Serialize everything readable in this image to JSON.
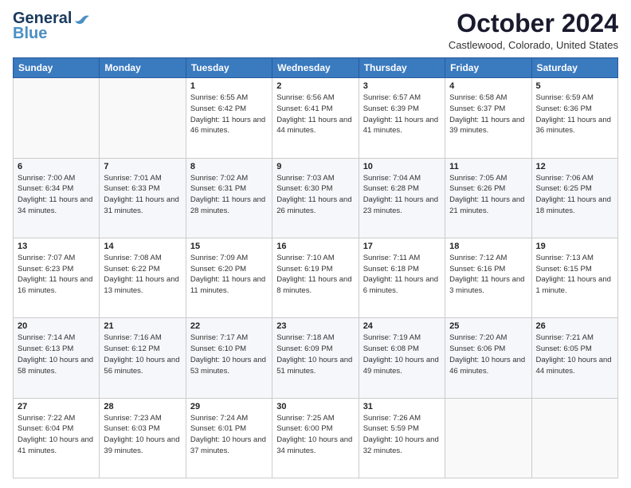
{
  "header": {
    "logo_line1": "General",
    "logo_line2": "Blue",
    "month": "October 2024",
    "location": "Castlewood, Colorado, United States"
  },
  "days_of_week": [
    "Sunday",
    "Monday",
    "Tuesday",
    "Wednesday",
    "Thursday",
    "Friday",
    "Saturday"
  ],
  "weeks": [
    [
      {
        "day": "",
        "sunrise": "",
        "sunset": "",
        "daylight": ""
      },
      {
        "day": "",
        "sunrise": "",
        "sunset": "",
        "daylight": ""
      },
      {
        "day": "1",
        "sunrise": "Sunrise: 6:55 AM",
        "sunset": "Sunset: 6:42 PM",
        "daylight": "Daylight: 11 hours and 46 minutes."
      },
      {
        "day": "2",
        "sunrise": "Sunrise: 6:56 AM",
        "sunset": "Sunset: 6:41 PM",
        "daylight": "Daylight: 11 hours and 44 minutes."
      },
      {
        "day": "3",
        "sunrise": "Sunrise: 6:57 AM",
        "sunset": "Sunset: 6:39 PM",
        "daylight": "Daylight: 11 hours and 41 minutes."
      },
      {
        "day": "4",
        "sunrise": "Sunrise: 6:58 AM",
        "sunset": "Sunset: 6:37 PM",
        "daylight": "Daylight: 11 hours and 39 minutes."
      },
      {
        "day": "5",
        "sunrise": "Sunrise: 6:59 AM",
        "sunset": "Sunset: 6:36 PM",
        "daylight": "Daylight: 11 hours and 36 minutes."
      }
    ],
    [
      {
        "day": "6",
        "sunrise": "Sunrise: 7:00 AM",
        "sunset": "Sunset: 6:34 PM",
        "daylight": "Daylight: 11 hours and 34 minutes."
      },
      {
        "day": "7",
        "sunrise": "Sunrise: 7:01 AM",
        "sunset": "Sunset: 6:33 PM",
        "daylight": "Daylight: 11 hours and 31 minutes."
      },
      {
        "day": "8",
        "sunrise": "Sunrise: 7:02 AM",
        "sunset": "Sunset: 6:31 PM",
        "daylight": "Daylight: 11 hours and 28 minutes."
      },
      {
        "day": "9",
        "sunrise": "Sunrise: 7:03 AM",
        "sunset": "Sunset: 6:30 PM",
        "daylight": "Daylight: 11 hours and 26 minutes."
      },
      {
        "day": "10",
        "sunrise": "Sunrise: 7:04 AM",
        "sunset": "Sunset: 6:28 PM",
        "daylight": "Daylight: 11 hours and 23 minutes."
      },
      {
        "day": "11",
        "sunrise": "Sunrise: 7:05 AM",
        "sunset": "Sunset: 6:26 PM",
        "daylight": "Daylight: 11 hours and 21 minutes."
      },
      {
        "day": "12",
        "sunrise": "Sunrise: 7:06 AM",
        "sunset": "Sunset: 6:25 PM",
        "daylight": "Daylight: 11 hours and 18 minutes."
      }
    ],
    [
      {
        "day": "13",
        "sunrise": "Sunrise: 7:07 AM",
        "sunset": "Sunset: 6:23 PM",
        "daylight": "Daylight: 11 hours and 16 minutes."
      },
      {
        "day": "14",
        "sunrise": "Sunrise: 7:08 AM",
        "sunset": "Sunset: 6:22 PM",
        "daylight": "Daylight: 11 hours and 13 minutes."
      },
      {
        "day": "15",
        "sunrise": "Sunrise: 7:09 AM",
        "sunset": "Sunset: 6:20 PM",
        "daylight": "Daylight: 11 hours and 11 minutes."
      },
      {
        "day": "16",
        "sunrise": "Sunrise: 7:10 AM",
        "sunset": "Sunset: 6:19 PM",
        "daylight": "Daylight: 11 hours and 8 minutes."
      },
      {
        "day": "17",
        "sunrise": "Sunrise: 7:11 AM",
        "sunset": "Sunset: 6:18 PM",
        "daylight": "Daylight: 11 hours and 6 minutes."
      },
      {
        "day": "18",
        "sunrise": "Sunrise: 7:12 AM",
        "sunset": "Sunset: 6:16 PM",
        "daylight": "Daylight: 11 hours and 3 minutes."
      },
      {
        "day": "19",
        "sunrise": "Sunrise: 7:13 AM",
        "sunset": "Sunset: 6:15 PM",
        "daylight": "Daylight: 11 hours and 1 minute."
      }
    ],
    [
      {
        "day": "20",
        "sunrise": "Sunrise: 7:14 AM",
        "sunset": "Sunset: 6:13 PM",
        "daylight": "Daylight: 10 hours and 58 minutes."
      },
      {
        "day": "21",
        "sunrise": "Sunrise: 7:16 AM",
        "sunset": "Sunset: 6:12 PM",
        "daylight": "Daylight: 10 hours and 56 minutes."
      },
      {
        "day": "22",
        "sunrise": "Sunrise: 7:17 AM",
        "sunset": "Sunset: 6:10 PM",
        "daylight": "Daylight: 10 hours and 53 minutes."
      },
      {
        "day": "23",
        "sunrise": "Sunrise: 7:18 AM",
        "sunset": "Sunset: 6:09 PM",
        "daylight": "Daylight: 10 hours and 51 minutes."
      },
      {
        "day": "24",
        "sunrise": "Sunrise: 7:19 AM",
        "sunset": "Sunset: 6:08 PM",
        "daylight": "Daylight: 10 hours and 49 minutes."
      },
      {
        "day": "25",
        "sunrise": "Sunrise: 7:20 AM",
        "sunset": "Sunset: 6:06 PM",
        "daylight": "Daylight: 10 hours and 46 minutes."
      },
      {
        "day": "26",
        "sunrise": "Sunrise: 7:21 AM",
        "sunset": "Sunset: 6:05 PM",
        "daylight": "Daylight: 10 hours and 44 minutes."
      }
    ],
    [
      {
        "day": "27",
        "sunrise": "Sunrise: 7:22 AM",
        "sunset": "Sunset: 6:04 PM",
        "daylight": "Daylight: 10 hours and 41 minutes."
      },
      {
        "day": "28",
        "sunrise": "Sunrise: 7:23 AM",
        "sunset": "Sunset: 6:03 PM",
        "daylight": "Daylight: 10 hours and 39 minutes."
      },
      {
        "day": "29",
        "sunrise": "Sunrise: 7:24 AM",
        "sunset": "Sunset: 6:01 PM",
        "daylight": "Daylight: 10 hours and 37 minutes."
      },
      {
        "day": "30",
        "sunrise": "Sunrise: 7:25 AM",
        "sunset": "Sunset: 6:00 PM",
        "daylight": "Daylight: 10 hours and 34 minutes."
      },
      {
        "day": "31",
        "sunrise": "Sunrise: 7:26 AM",
        "sunset": "Sunset: 5:59 PM",
        "daylight": "Daylight: 10 hours and 32 minutes."
      },
      {
        "day": "",
        "sunrise": "",
        "sunset": "",
        "daylight": ""
      },
      {
        "day": "",
        "sunrise": "",
        "sunset": "",
        "daylight": ""
      }
    ]
  ]
}
